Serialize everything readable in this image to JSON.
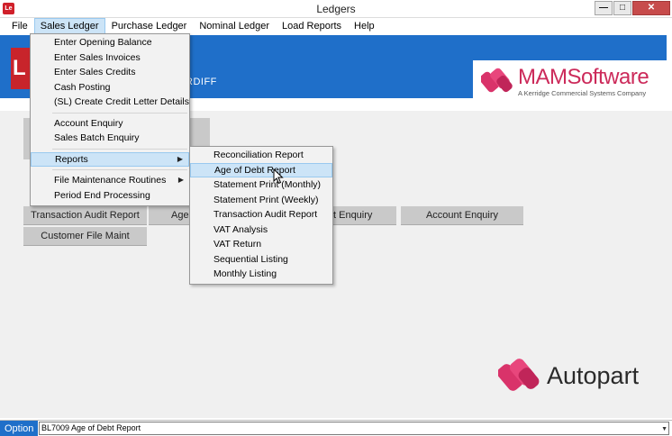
{
  "window": {
    "title": "Ledgers",
    "app_icon": "Le",
    "controls": [
      "minimize-icon",
      "maximize-icon",
      "close-icon"
    ]
  },
  "menubar": {
    "items": [
      "File",
      "Sales Ledger",
      "Purchase Ledger",
      "Nominal Ledger",
      "Load Reports",
      "Help"
    ],
    "open_index": 1
  },
  "banner": {
    "logo_letter": "L",
    "location": "RDIFF",
    "brand_name": "MAMSoftware",
    "brand_tagline": "A Kerridge Commercial Systems Company",
    "brand_color": "#cc2a5a",
    "banner_color": "#1f6fc9"
  },
  "buttons": {
    "transaction_audit_report": "Transaction Audit Report",
    "age_partial": "Age",
    "enquiry_partial": "t Enquiry",
    "account_enquiry": "Account Enquiry",
    "customer_file_maint": "Customer File Maint"
  },
  "sales_ledger_menu": {
    "group1": [
      "Enter Opening Balance",
      "Enter Sales Invoices",
      "Enter Sales Credits",
      "Cash Posting",
      "(SL) Create Credit Letter Details"
    ],
    "group2": [
      "Account Enquiry",
      "Sales Batch Enquiry"
    ],
    "reports": "Reports",
    "group3": [
      "File Maintenance Routines",
      "Period End Processing"
    ]
  },
  "reports_menu": {
    "items": [
      "Reconciliation Report",
      "Age of Debt Report",
      "Statement Print (Monthly)",
      "Statement Print (Weekly)",
      "Transaction Audit Report",
      "VAT Analysis",
      "VAT Return",
      "Sequential Listing",
      "Monthly Listing"
    ],
    "highlighted_index": 1
  },
  "autopart": {
    "name": "Autopart"
  },
  "option_bar": {
    "label": "Option",
    "value": "BL7009   Age of Debt Report"
  }
}
